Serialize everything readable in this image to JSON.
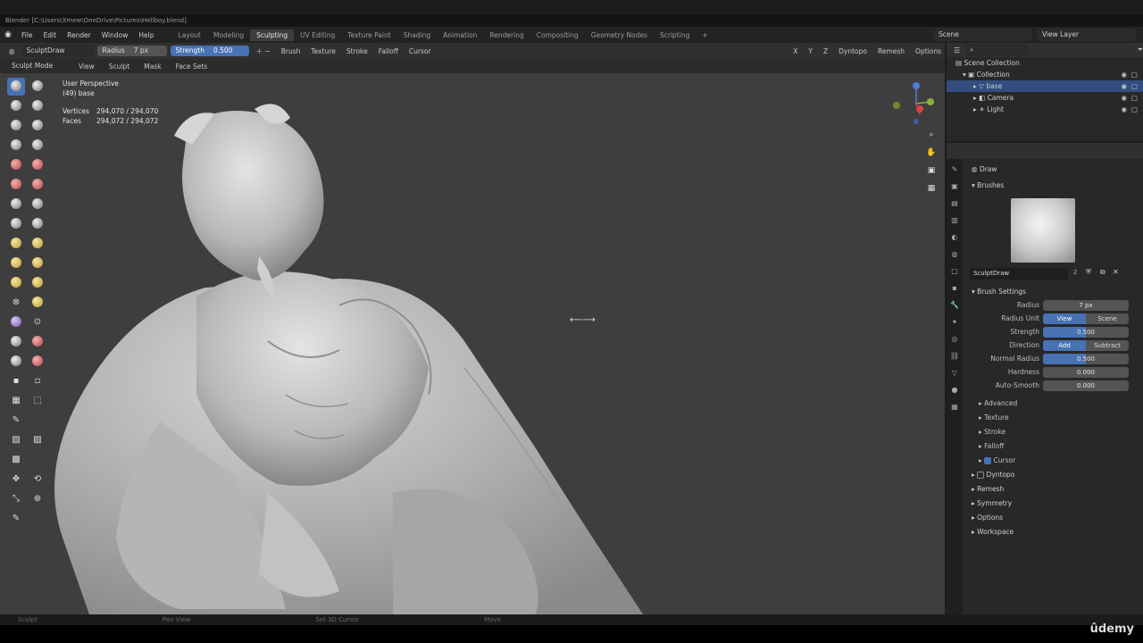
{
  "window": {
    "title": "Blender [C:\\Users\\Xmew\\OneDrive\\Pictures\\Hellboy.blend]"
  },
  "menu": {
    "items": [
      "File",
      "Edit",
      "Render",
      "Window",
      "Help"
    ]
  },
  "workspaces": [
    "Layout",
    "Modeling",
    "Sculpting",
    "UV Editing",
    "Texture Paint",
    "Shading",
    "Animation",
    "Rendering",
    "Compositing",
    "Geometry Nodes",
    "Scripting"
  ],
  "active_workspace": "Sculpting",
  "scene_field": "Scene",
  "view_layer_field": "View Layer",
  "tool_header": {
    "brush_name": "SculptDraw",
    "radius_label": "Radius",
    "radius_value": "7 px",
    "strength_label": "Strength",
    "strength_value": "0.500",
    "menus": [
      "Brush",
      "Texture",
      "Stroke",
      "Falloff",
      "Cursor"
    ],
    "axes": [
      "X",
      "Y",
      "Z"
    ],
    "right_menus": [
      "Dyntopo",
      "Remesh",
      "Options"
    ]
  },
  "mode_bar": {
    "mode": "Sculpt Mode",
    "items": [
      "View",
      "Sculpt",
      "Mask",
      "Face Sets"
    ]
  },
  "viewport": {
    "perspective": "User Perspective",
    "object": "(49) base",
    "vertices_label": "Vertices",
    "vertices_value": "294,070 / 294,070",
    "faces_label": "Faces",
    "faces_value": "294,072 / 294,072"
  },
  "outliner": {
    "root": "Scene Collection",
    "collection": "Collection",
    "objects": [
      "base",
      "Camera",
      "Light"
    ]
  },
  "properties": {
    "tool_name": "Draw",
    "brushes_header": "Brushes",
    "brush_field": "SculptDraw",
    "brush_users": "2",
    "brush_settings_header": "Brush Settings",
    "radius_label": "Radius",
    "radius_value": "7 px",
    "radius_unit_label": "Radius Unit",
    "radius_unit_options": [
      "View",
      "Scene"
    ],
    "strength_label": "Strength",
    "strength_value": "0.500",
    "strength_fraction": 0.5,
    "direction_label": "Direction",
    "direction_options": [
      "Add",
      "Subtract"
    ],
    "normal_radius_label": "Normal Radius",
    "normal_radius_value": "0.500",
    "normal_radius_fraction": 0.5,
    "hardness_label": "Hardness",
    "hardness_value": "0.000",
    "autosmooth_label": "Auto-Smooth",
    "autosmooth_value": "0.000",
    "subpanels": [
      "Advanced",
      "Texture",
      "Stroke",
      "Falloff",
      "Cursor"
    ],
    "panels": [
      "Dyntopo",
      "Remesh",
      "Symmetry",
      "Options",
      "Workspace"
    ]
  },
  "statusbar": {
    "items": [
      "Sculpt",
      "Pan View",
      "Set 3D Cursor",
      "Move"
    ]
  },
  "watermark": "ûdemy"
}
